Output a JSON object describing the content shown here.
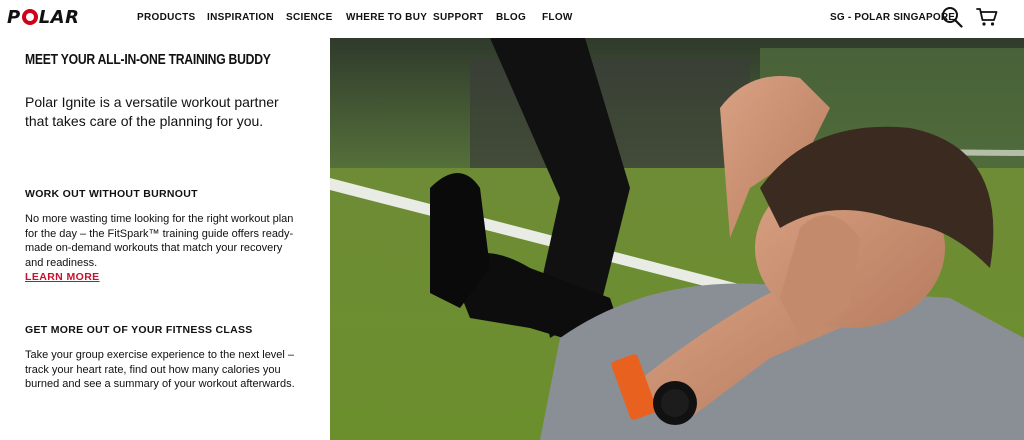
{
  "brand": {
    "logo_text_left": "P",
    "logo_text_right": "LAR"
  },
  "nav": {
    "items": [
      "PRODUCTS",
      "INSPIRATION",
      "SCIENCE",
      "WHERE TO BUY",
      "SUPPORT",
      "BLOG",
      "FLOW"
    ],
    "region_label": "SG - POLAR SINGAPORE"
  },
  "icons": {
    "search": "search-icon",
    "cart": "cart-icon"
  },
  "content": {
    "title": "MEET YOUR ALL-IN-ONE TRAINING BUDDY",
    "intro": "Polar Ignite is a versatile workout partner that takes care of the planning for you.",
    "sections": [
      {
        "heading": "WORK OUT WITHOUT BURNOUT",
        "body": "No more wasting time looking for the right workout plan for the day – the FitSpark™ training guide offers ready-made on-demand workouts that match your recovery and readiness.",
        "link": "LEARN MORE"
      },
      {
        "heading": "GET MORE OUT OF YOUR FITNESS CLASS",
        "body": "Take your group exercise experience to the next level – track your heart rate, find out how many calories you burned and see a summary of your workout afterwards."
      }
    ]
  },
  "colors": {
    "accent": "#c8102e",
    "logo_red": "#d10019",
    "text": "#111111",
    "watch_strap": "#e8611f"
  }
}
